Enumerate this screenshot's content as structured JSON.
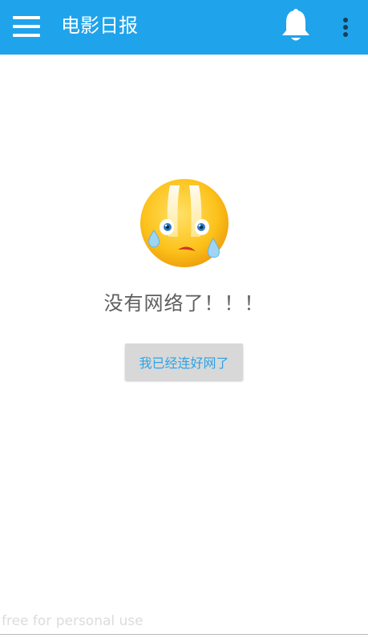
{
  "header": {
    "title": "电影日报",
    "menu_icon": "menu-icon",
    "notification_icon": "bell-icon",
    "overflow_icon": "more-vert-icon",
    "background_color": "#1fa3eb"
  },
  "error_state": {
    "icon": "crying-face-icon",
    "message": "没有网络了！！！",
    "retry_button_label": "我已经连好网了",
    "button_text_color": "#2da3e6"
  },
  "watermark": "free for personal use"
}
